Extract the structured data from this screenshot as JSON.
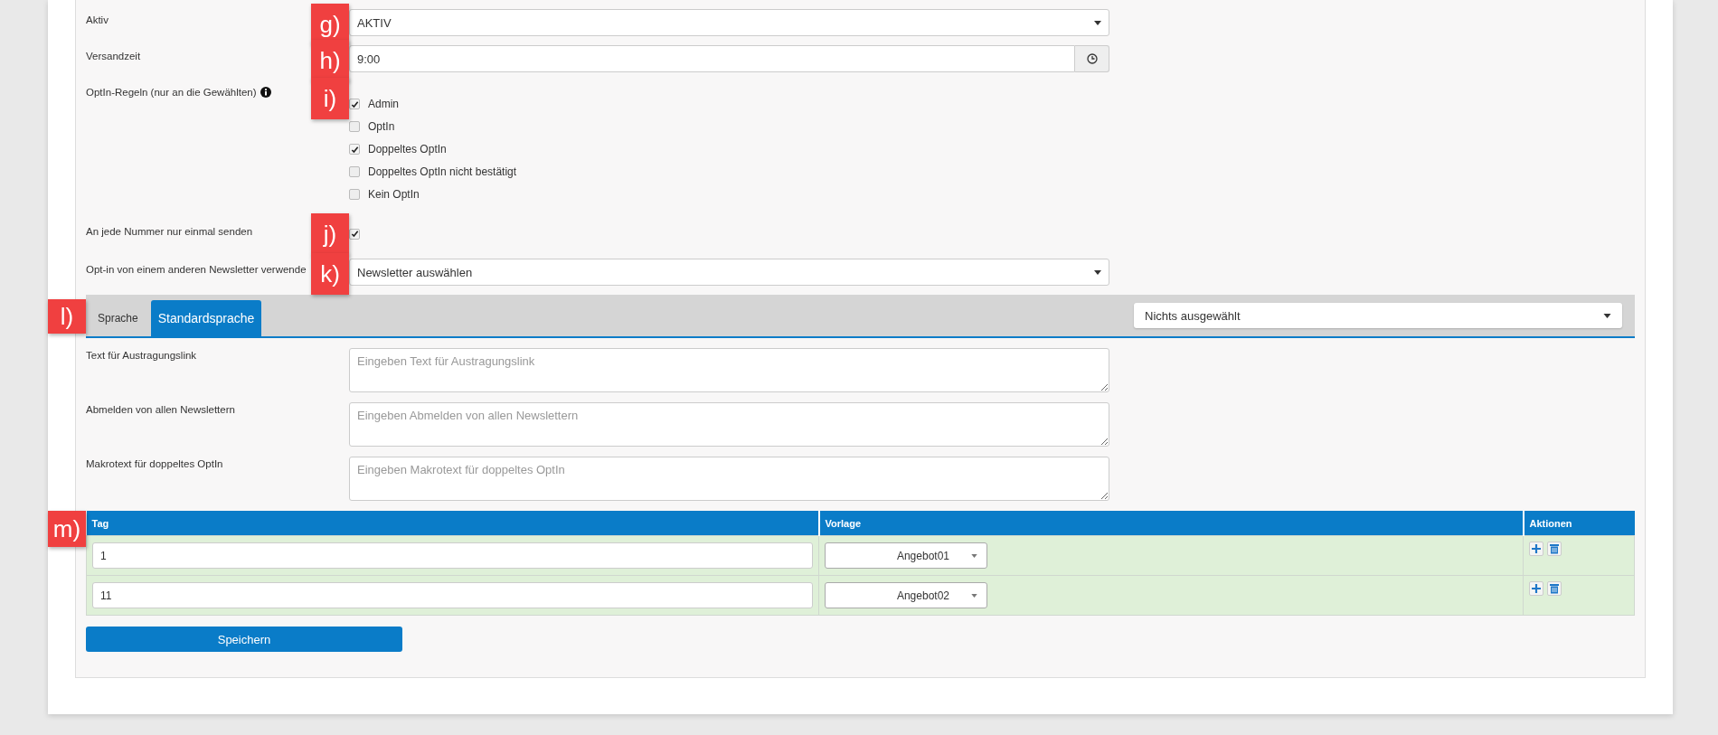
{
  "fields": [
    {
      "kind": "select",
      "label": "Aktiv",
      "marker": "g)",
      "value": "AKTIV"
    },
    {
      "kind": "time",
      "label": "Versandzeit",
      "marker": "h)",
      "value": "9:00"
    },
    {
      "kind": "checklist",
      "label": "OptIn-Regeln (nur an die Gewählten)",
      "info": true,
      "marker": "i)",
      "options": [
        {
          "label": "Admin",
          "checked": true
        },
        {
          "label": "OptIn",
          "checked": false
        },
        {
          "label": "Doppeltes OptIn",
          "checked": true
        },
        {
          "label": "Doppeltes OptIn nicht bestätigt",
          "checked": false
        },
        {
          "label": "Kein OptIn",
          "checked": false
        }
      ]
    },
    {
      "kind": "checkbox",
      "label": "An jede Nummer nur einmal senden",
      "marker": "j)",
      "checked": true
    },
    {
      "kind": "select",
      "label": "Opt-in von einem anderen Newsletter verwende",
      "marker": "k)",
      "value": "Newsletter auswählen"
    }
  ],
  "language": {
    "marker": "l)",
    "tabs": [
      {
        "label": "Sprache",
        "selected": false
      },
      {
        "label": "Standardsprache",
        "selected": true
      }
    ],
    "select": "Nichts ausgewählt"
  },
  "texts": [
    {
      "label": "Text für Austragungslink",
      "placeholder": "Eingeben Text für Austragungslink"
    },
    {
      "label": "Abmelden von allen Newslettern",
      "placeholder": "Eingeben Abmelden von allen Newslettern"
    },
    {
      "label": "Makrotext für doppeltes OptIn",
      "placeholder": "Eingeben Makrotext für doppeltes OptIn"
    }
  ],
  "table": {
    "marker": "m)",
    "columns": [
      "Tag",
      "Vorlage",
      "Aktionen"
    ],
    "rows": [
      {
        "tag": "1",
        "template": "Angebot01"
      },
      {
        "tag": "11",
        "template": "Angebot02"
      }
    ]
  },
  "save_button": "Speichern"
}
